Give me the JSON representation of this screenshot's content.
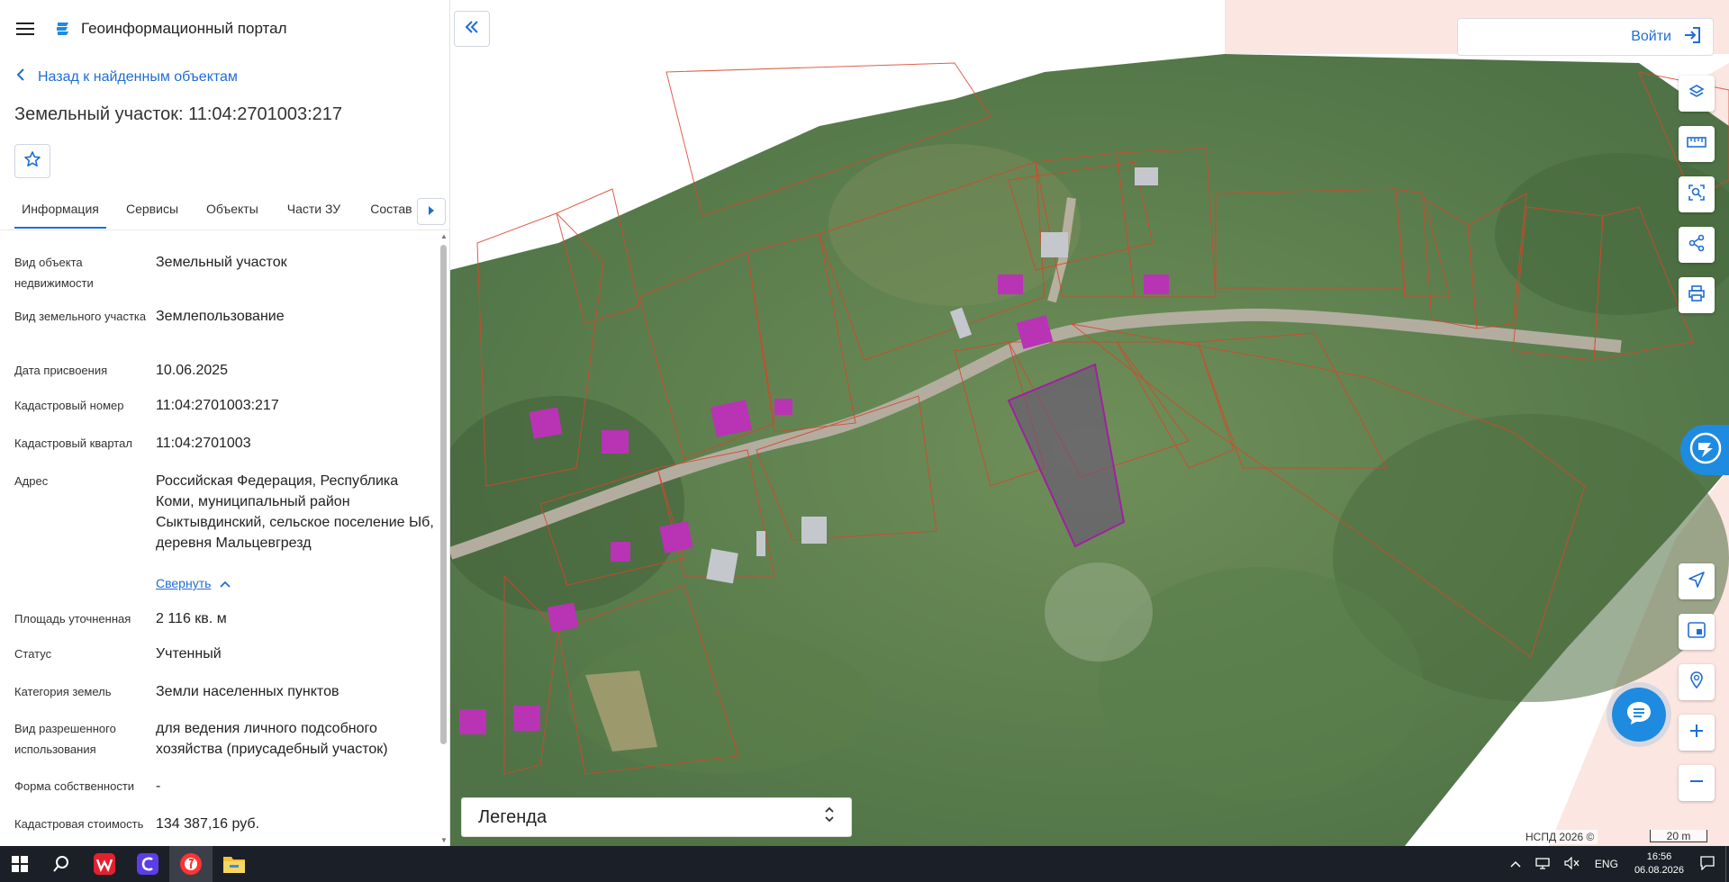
{
  "header": {
    "portal_title": "Геоинформационный портал"
  },
  "nav": {
    "back_label": "Назад к найденным объектам"
  },
  "object": {
    "title": "Земельный участок: 11:04:2701003:217"
  },
  "tabs": [
    {
      "label": "Информация",
      "active": true
    },
    {
      "label": "Сервисы",
      "active": false
    },
    {
      "label": "Объекты",
      "active": false
    },
    {
      "label": "Части ЗУ",
      "active": false
    },
    {
      "label": "Состав",
      "active": false
    }
  ],
  "info": [
    {
      "label": "Вид объекта недвижимости",
      "value": "Земельный участок"
    },
    {
      "label": "Вид земельного участка",
      "value": "Землепользование"
    },
    {
      "label": "Дата присвоения",
      "value": "10.06.2025"
    },
    {
      "label": "Кадастровый номер",
      "value": "11:04:2701003:217"
    },
    {
      "label": "Кадастровый квартал",
      "value": "11:04:2701003"
    },
    {
      "label": "Адрес",
      "value": "Российская Федерация, Республика Коми, муниципальный район Сыктывдинский, сельское поселение Ыб, деревня Мальцевгрезд"
    },
    {
      "label": "Площадь уточненная",
      "value": "2 116 кв. м"
    },
    {
      "label": "Статус",
      "value": "Учтенный"
    },
    {
      "label": "Категория земель",
      "value": "Земли населенных пунктов"
    },
    {
      "label": "Вид разрешенного использования",
      "value": "для ведения личного подсобного хозяйства (приусадебный участок)"
    },
    {
      "label": "Форма собственности",
      "value": "-"
    },
    {
      "label": "Кадастровая стоимость",
      "value": "134 387,16 руб."
    }
  ],
  "address_collapse_label": "Свернуть",
  "map": {
    "login_label": "Войти",
    "legend_label": "Легенда",
    "copyright": "НСПД 2026 ©",
    "scale_label": "20 m",
    "tools_top": [
      "layers-icon",
      "ruler-icon",
      "select-area-icon",
      "share-icon",
      "print-icon"
    ],
    "tools_bottom": [
      "navigate-icon",
      "minimap-icon",
      "geolocate-icon",
      "zoom-in-icon",
      "zoom-out-icon"
    ]
  },
  "taskbar": {
    "apps": [
      "windows-start-icon",
      "search-icon",
      "wps-office-icon",
      "app-c-icon",
      "yandex-browser-icon",
      "file-explorer-icon"
    ],
    "lang": "ENG",
    "time": "16:56",
    "date": "06.08.2026"
  },
  "colors": {
    "accent": "#1f6ed4",
    "selected_parcel": "#a020a0",
    "parcel_border": "#d9442b",
    "fab": "#1e8be0"
  }
}
